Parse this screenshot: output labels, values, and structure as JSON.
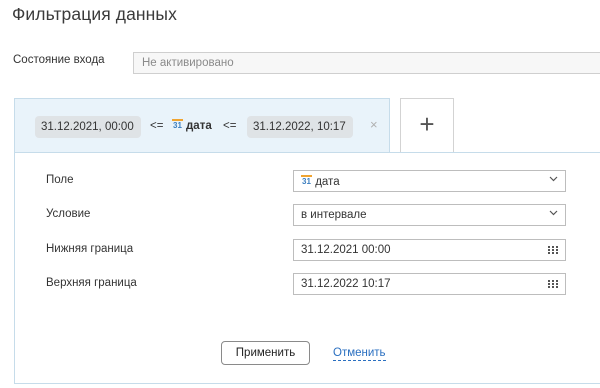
{
  "title": "Фильтрация данных",
  "login_state": {
    "label": "Состояние входа",
    "value": "Не активировано"
  },
  "filter_tab": {
    "from_value": "31.12.2021, 00:00",
    "op_left": "<=",
    "field_icon_text": "31",
    "field_name": "дата",
    "op_right": "<=",
    "to_value": "31.12.2022, 10:17",
    "remove_symbol": "×"
  },
  "add_tab": {
    "symbol": "+"
  },
  "form": {
    "field": {
      "label": "Поле",
      "icon_text": "31",
      "value": "дата"
    },
    "condition": {
      "label": "Условие",
      "value": "в интервале"
    },
    "lower": {
      "label": "Нижняя граница",
      "value": "31.12.2021 00:00"
    },
    "upper": {
      "label": "Верхняя граница",
      "value": "31.12.2022 10:17"
    }
  },
  "actions": {
    "apply_label": "Применить",
    "cancel_label": "Отменить"
  },
  "colors": {
    "accent": "#2a6fc0",
    "tab_bg": "#e9f3fa",
    "calendar_bar": "#f0a430"
  },
  "icons": {
    "field_type": "calendar-icon",
    "dropdown": "chevron-down-icon",
    "date_picker": "grid-calendar-icon"
  }
}
